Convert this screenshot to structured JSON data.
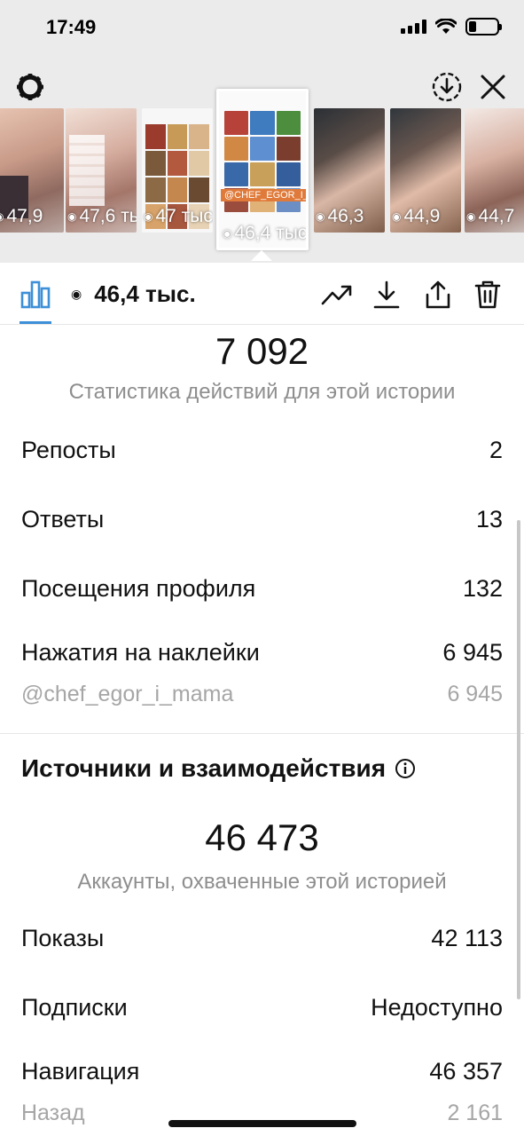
{
  "status_bar": {
    "time": "17:49"
  },
  "thumbnails": [
    {
      "views": "47,9"
    },
    {
      "views": "47,6 тыс."
    },
    {
      "views": "47 тыс."
    },
    {
      "views": "46,4 тыс.",
      "tag": "@CHEF_EGOR_I_MAMA",
      "selected": true
    },
    {
      "views": "46,3"
    },
    {
      "views": "44,9"
    },
    {
      "views": "44,7"
    }
  ],
  "toolbar": {
    "views": "46,4 тыс."
  },
  "actions": {
    "total": "7 092",
    "caption": "Статистика действий для этой истории",
    "rows": [
      {
        "label": "Репосты",
        "value": "2"
      },
      {
        "label": "Ответы",
        "value": "13"
      },
      {
        "label": "Посещения профиля",
        "value": "132"
      },
      {
        "label": "Нажатия на наклейки",
        "value": "6 945"
      }
    ],
    "sticker": {
      "label": "@chef_egor_i_mama",
      "value": "6 945"
    }
  },
  "reach": {
    "title": "Источники и взаимодействия",
    "total": "46 473",
    "caption": "Аккаунты, охваченные этой историей",
    "rows": [
      {
        "label": "Показы",
        "value": "42 113"
      },
      {
        "label": "Подписки",
        "value": "Недоступно"
      },
      {
        "label": "Навигация",
        "value": "46 357"
      }
    ],
    "sub": {
      "label": "Назад",
      "value": "2 161"
    }
  },
  "colors": {
    "accent": "#3d8fd8",
    "muted": "#8e8e8e",
    "tag": "#e07a3a"
  }
}
